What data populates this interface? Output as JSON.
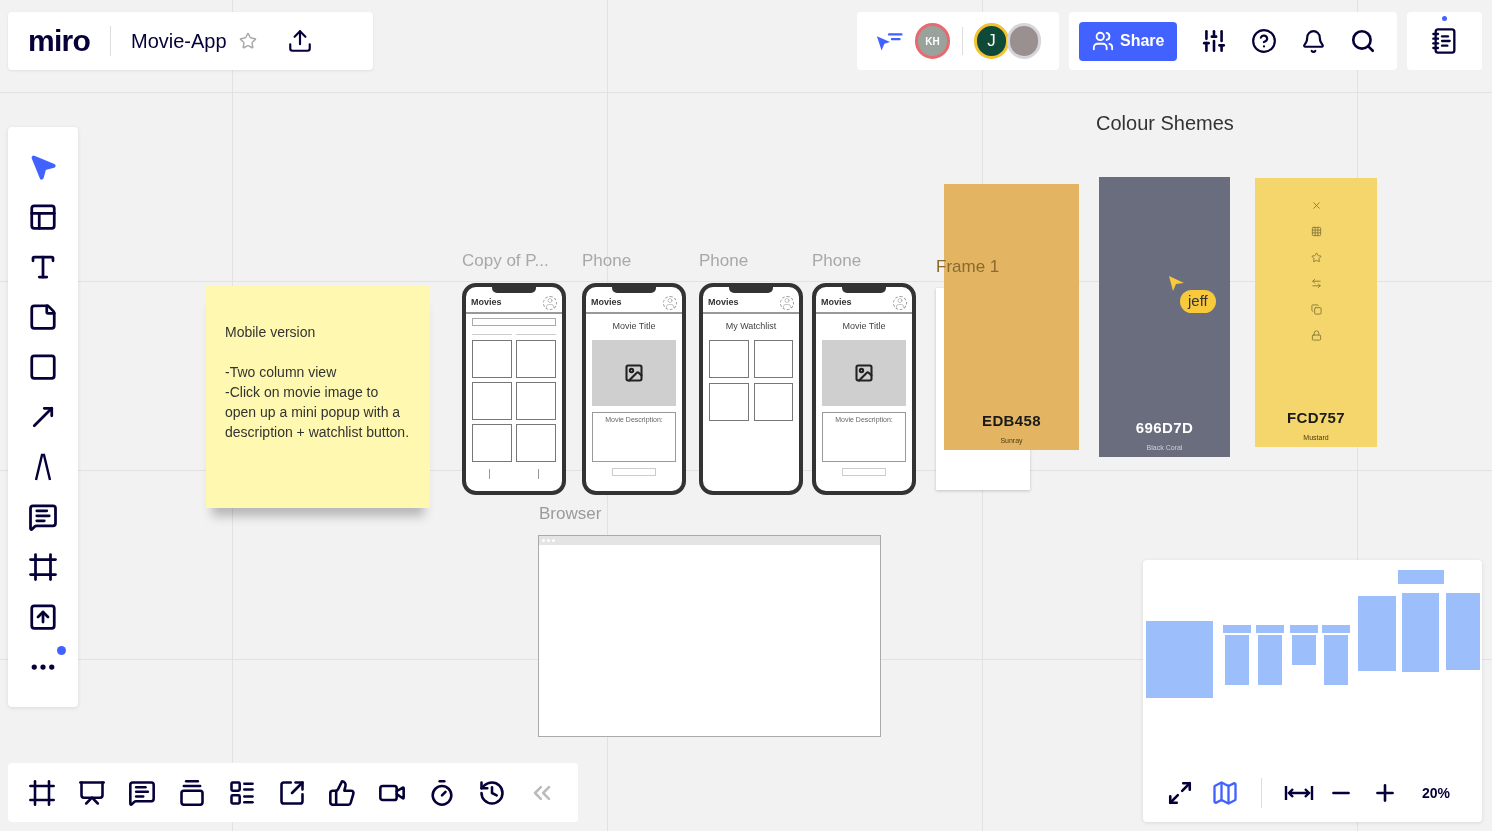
{
  "header": {
    "logo": "miro",
    "board_title": "Movie-App",
    "starred": false
  },
  "collaborators": [
    {
      "kind": "initials",
      "initials": "KH",
      "color": "#e8696f"
    },
    {
      "kind": "initials",
      "initials": "J",
      "color": "#f2c230"
    },
    {
      "kind": "photo",
      "color": "#d6d6da"
    }
  ],
  "share": {
    "label": "Share"
  },
  "notes_dot": true,
  "tools": [
    {
      "kind": "select",
      "selected": true
    },
    {
      "kind": "templates",
      "selected": false
    },
    {
      "kind": "text",
      "selected": false
    },
    {
      "kind": "sticky",
      "selected": false
    },
    {
      "kind": "shape",
      "selected": false
    },
    {
      "kind": "line",
      "selected": false
    },
    {
      "kind": "pen",
      "selected": false
    },
    {
      "kind": "comment",
      "selected": false
    },
    {
      "kind": "frame",
      "selected": false
    },
    {
      "kind": "upload",
      "selected": false
    },
    {
      "kind": "more",
      "selected": false,
      "dot": true
    }
  ],
  "canvas": {
    "sticky_note": {
      "title": "Mobile version",
      "lines": [
        "-Two column view",
        "-Click on movie image to open up a mini popup with a description + watchlist button."
      ]
    },
    "phones": [
      {
        "label": "Copy of P...",
        "kind": "grid",
        "header": "Movies"
      },
      {
        "label": "Phone",
        "kind": "detail",
        "header": "Movies",
        "title": "Movie Title",
        "description": "Movie Description:"
      },
      {
        "label": "Phone",
        "kind": "watchlist",
        "header": "Movies",
        "title": "My Watchlist"
      },
      {
        "label": "Phone",
        "kind": "detail",
        "header": "Movies",
        "title": "Movie Title",
        "description": "Movie Description:"
      }
    ],
    "frame": {
      "label": "Frame 1"
    },
    "browser": {
      "label": "Browser"
    },
    "palette_heading": "Colour Shemes",
    "swatches": [
      {
        "kind": "plain",
        "hex": "EDB458",
        "name": "Sunray",
        "color": "#e3b562"
      },
      {
        "kind": "plain",
        "hex": "696D7D",
        "name": "Black Coral",
        "color": "#696d7d"
      },
      {
        "kind": "icons",
        "hex": "FCD757",
        "name": "Mustard",
        "color": "#f5d66c"
      }
    ],
    "cursor": {
      "name": "jeff",
      "color": "#f8c93a"
    }
  },
  "bottom_tools": [
    {
      "kind": "frames"
    },
    {
      "kind": "present"
    },
    {
      "kind": "comments"
    },
    {
      "kind": "cards"
    },
    {
      "kind": "kanban"
    },
    {
      "kind": "share"
    },
    {
      "kind": "vote"
    },
    {
      "kind": "video"
    },
    {
      "kind": "timer"
    },
    {
      "kind": "history"
    },
    {
      "kind": "collapse"
    }
  ],
  "minimap": {
    "zoom": "20%"
  }
}
